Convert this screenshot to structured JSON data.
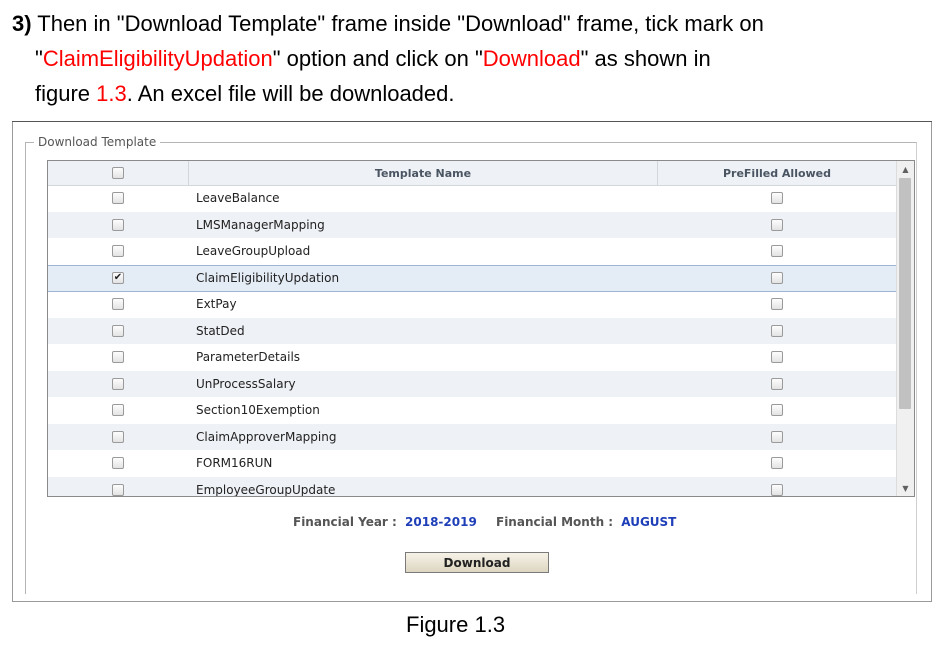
{
  "instruction": {
    "step_num": "3)",
    "t1": " Then in \"Download Template\" frame inside \"Download\" frame, tick mark on",
    "q1": "\"",
    "option_name": "ClaimEligibilityUpdation",
    "t2": "\" option and click on \"",
    "button_name": "Download",
    "t3": "\" as shown in",
    "t4": "figure ",
    "fig_ref": "1.3",
    "t5": ". An excel file will be downloaded."
  },
  "frame": {
    "legend": "Download Template",
    "headers": {
      "name": "Template Name",
      "prefilled": "PreFilled Allowed"
    },
    "select_all_checked": false,
    "rows": [
      {
        "name": "LeaveBalance",
        "checked": false,
        "prefilled": false
      },
      {
        "name": "LMSManagerMapping",
        "checked": false,
        "prefilled": false
      },
      {
        "name": "LeaveGroupUpload",
        "checked": false,
        "prefilled": false
      },
      {
        "name": "ClaimEligibilityUpdation",
        "checked": true,
        "prefilled": false
      },
      {
        "name": "ExtPay",
        "checked": false,
        "prefilled": false
      },
      {
        "name": "StatDed",
        "checked": false,
        "prefilled": false
      },
      {
        "name": "ParameterDetails",
        "checked": false,
        "prefilled": false
      },
      {
        "name": "UnProcessSalary",
        "checked": false,
        "prefilled": false
      },
      {
        "name": "Section10Exemption",
        "checked": false,
        "prefilled": false
      },
      {
        "name": "ClaimApproverMapping",
        "checked": false,
        "prefilled": false
      },
      {
        "name": "FORM16RUN",
        "checked": false,
        "prefilled": false
      },
      {
        "name": "EmployeeGroupUpdate",
        "checked": false,
        "prefilled": false
      }
    ],
    "financial_year_label": "Financial Year :",
    "financial_year_value": "2018-2019",
    "financial_month_label": "Financial Month :",
    "financial_month_value": "AUGUST",
    "download_label": "Download"
  },
  "caption": "Figure 1.3"
}
